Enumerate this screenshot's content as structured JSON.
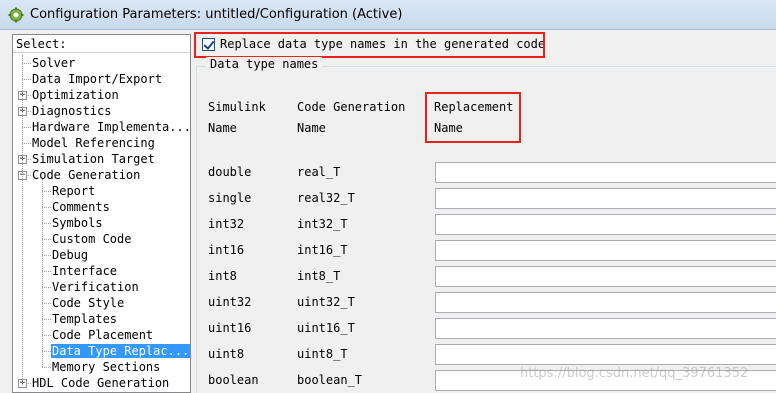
{
  "window": {
    "title": "Configuration Parameters: untitled/Configuration (Active)"
  },
  "tree": {
    "header": "Select:",
    "items": [
      {
        "label": "Solver",
        "level": 0,
        "expandable": false
      },
      {
        "label": "Data Import/Export",
        "level": 0,
        "expandable": false
      },
      {
        "label": "Optimization",
        "level": 0,
        "expandable": true,
        "expanded": false
      },
      {
        "label": "Diagnostics",
        "level": 0,
        "expandable": true,
        "expanded": false
      },
      {
        "label": "Hardware Implementa...",
        "level": 0,
        "expandable": false
      },
      {
        "label": "Model Referencing",
        "level": 0,
        "expandable": false
      },
      {
        "label": "Simulation Target",
        "level": 0,
        "expandable": true,
        "expanded": false
      },
      {
        "label": "Code Generation",
        "level": 0,
        "expandable": true,
        "expanded": true
      },
      {
        "label": "Report",
        "level": 1
      },
      {
        "label": "Comments",
        "level": 1
      },
      {
        "label": "Symbols",
        "level": 1
      },
      {
        "label": "Custom Code",
        "level": 1
      },
      {
        "label": "Debug",
        "level": 1
      },
      {
        "label": "Interface",
        "level": 1
      },
      {
        "label": "Verification",
        "level": 1
      },
      {
        "label": "Code Style",
        "level": 1
      },
      {
        "label": "Templates",
        "level": 1
      },
      {
        "label": "Code Placement",
        "level": 1
      },
      {
        "label": "Data Type Replac...",
        "level": 1,
        "selected": true
      },
      {
        "label": "Memory Sections",
        "level": 1
      },
      {
        "label": "HDL Code Generation",
        "level": 0,
        "expandable": true,
        "expanded": false
      }
    ]
  },
  "main": {
    "checkbox_label": "Replace data type names in the generated code",
    "checkbox_checked": true,
    "group_title": "Data type names",
    "columns": {
      "simulink": [
        "Simulink",
        "Name"
      ],
      "codegen": [
        "Code Generation",
        "Name"
      ],
      "replacement": [
        "Replacement",
        "Name"
      ]
    },
    "rows": [
      {
        "simulink": "double",
        "codegen": "real_T",
        "replacement": ""
      },
      {
        "simulink": "single",
        "codegen": "real32_T",
        "replacement": ""
      },
      {
        "simulink": "int32",
        "codegen": "int32_T",
        "replacement": ""
      },
      {
        "simulink": "int16",
        "codegen": "int16_T",
        "replacement": ""
      },
      {
        "simulink": "int8",
        "codegen": "int8_T",
        "replacement": ""
      },
      {
        "simulink": "uint32",
        "codegen": "uint32_T",
        "replacement": ""
      },
      {
        "simulink": "uint16",
        "codegen": "uint16_T",
        "replacement": ""
      },
      {
        "simulink": "uint8",
        "codegen": "uint8_T",
        "replacement": ""
      },
      {
        "simulink": "boolean",
        "codegen": "boolean_T",
        "replacement": ""
      }
    ]
  },
  "watermark": "https://blog.csdn.net/qq_39761352",
  "colors": {
    "highlight_box": "#e8231d",
    "selection": "#3399ff"
  }
}
